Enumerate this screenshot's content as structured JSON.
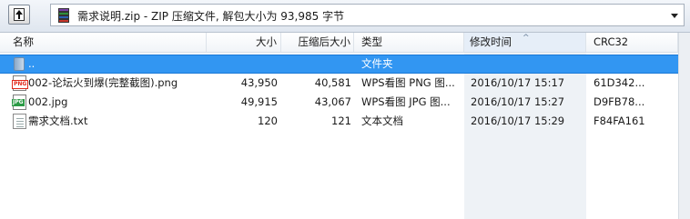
{
  "address": {
    "path_text": "需求说明.zip - ZIP 压缩文件, 解包大小为 93,985 字节"
  },
  "columns": {
    "name": "名称",
    "size": "大小",
    "packed": "压缩后大小",
    "type": "类型",
    "modified": "修改时间",
    "crc": "CRC32"
  },
  "rows": [
    {
      "name": "..",
      "size": "",
      "packed": "",
      "type": "文件夹",
      "modified": "",
      "crc": "",
      "icon": "folder-up-icon"
    },
    {
      "name": "002-论坛火到爆(完整截图).png",
      "size": "43,950",
      "packed": "40,581",
      "type": "WPS看图 PNG 图...",
      "modified": "2016/10/17 15:17",
      "crc": "61D342...",
      "icon": "png-file-icon"
    },
    {
      "name": "002.jpg",
      "size": "49,915",
      "packed": "43,067",
      "type": "WPS看图 JPG 图...",
      "modified": "2016/10/17 15:27",
      "crc": "D9FB78...",
      "icon": "jpg-file-icon"
    },
    {
      "name": "需求文档.txt",
      "size": "120",
      "packed": "121",
      "type": "文本文档",
      "modified": "2016/10/17 15:29",
      "crc": "F84FA161",
      "icon": "txt-file-icon"
    }
  ],
  "icons": {
    "png_badge": "PNG",
    "jpg_badge": "JPG"
  },
  "colors": {
    "selection": "#3296f2",
    "sorted_column": "#eef2f6"
  }
}
